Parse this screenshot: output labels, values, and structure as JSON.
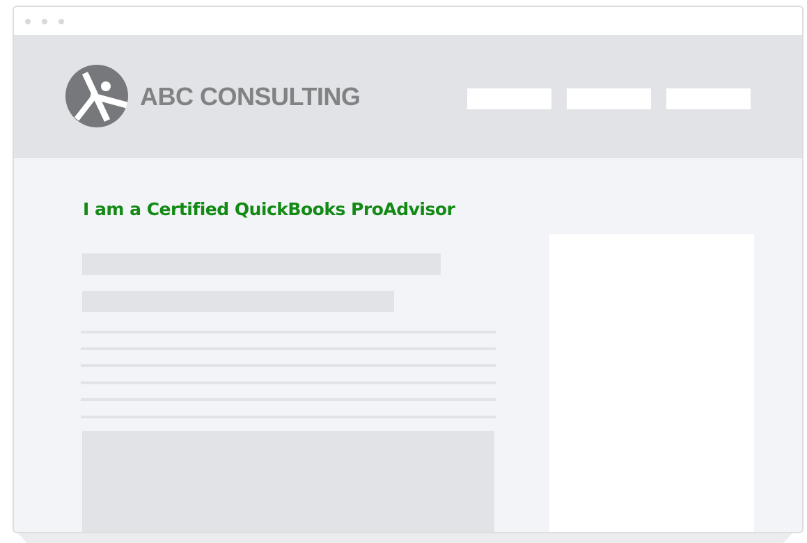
{
  "header": {
    "brand_name": "ABC CONSULTING",
    "logo_icon": "runner-in-circle-icon",
    "nav_items": [
      "",
      "",
      ""
    ]
  },
  "main": {
    "headline": "I am a Certified QuickBooks ProAdvisor"
  },
  "colors": {
    "headline_green": "#138a16",
    "brand_gray": "#808284",
    "header_bg": "#e2e3e6",
    "page_bg": "#f3f4f7"
  }
}
